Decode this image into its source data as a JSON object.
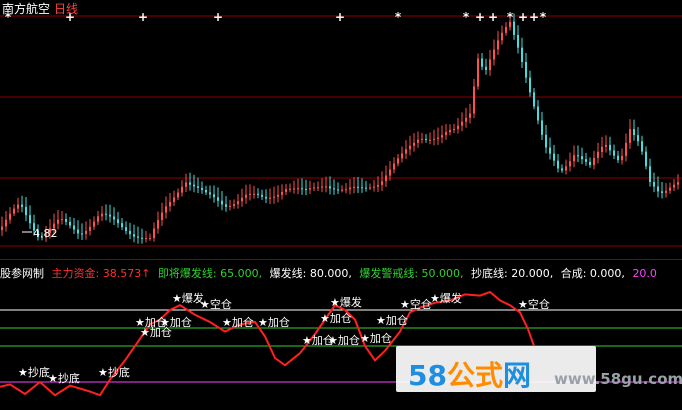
{
  "header": {
    "stock_name": "南方航空",
    "period": "日线"
  },
  "price_panel": {
    "low_marker": "4.82"
  },
  "indicator_bar": [
    {
      "text": "股参网制",
      "color": "#ffffff"
    },
    {
      "text": "主力资金: 38.573↑",
      "color": "#ff3030"
    },
    {
      "text": "即将爆发线: 65.000,",
      "color": "#30d030"
    },
    {
      "text": "爆发线: 80.000,",
      "color": "#ffffff"
    },
    {
      "text": "爆发警戒线: 50.000,",
      "color": "#30d030"
    },
    {
      "text": "抄底线: 20.000,",
      "color": "#ffffff"
    },
    {
      "text": "合成: 0.000,",
      "color": "#ffffff"
    },
    {
      "text": "20.0",
      "color": "#ff40ff"
    }
  ],
  "signals": [
    {
      "text": "★抄底",
      "label": "buy-bottom"
    },
    {
      "text": "★抄底",
      "label": "buy-bottom"
    },
    {
      "text": "★抄底",
      "label": "buy-bottom"
    },
    {
      "text": "★加仓",
      "label": "add-position"
    },
    {
      "text": "★加仓",
      "label": "add-position"
    },
    {
      "text": "★加仓",
      "label": "add-position"
    },
    {
      "text": "★加仓",
      "label": "add-position"
    },
    {
      "text": "★加仓",
      "label": "add-position"
    },
    {
      "text": "★加仓",
      "label": "add-position"
    },
    {
      "text": "★加仓",
      "label": "add-position"
    },
    {
      "text": "★加仓",
      "label": "add-position"
    },
    {
      "text": "★加仓",
      "label": "add-position"
    },
    {
      "text": "★加仓",
      "label": "add-position"
    },
    {
      "text": "★爆发",
      "label": "burst"
    },
    {
      "text": "★爆发",
      "label": "burst"
    },
    {
      "text": "★爆发",
      "label": "burst"
    },
    {
      "text": "★空仓",
      "label": "empty-position"
    },
    {
      "text": "★空仓",
      "label": "empty-position"
    },
    {
      "text": "★空仓",
      "label": "empty-position"
    }
  ],
  "watermark": {
    "number": "58",
    "name": "公式",
    "suffix": "网",
    "url": "www.58gu.com"
  },
  "colors": {
    "up": "#ff5050",
    "down": "#40e0e0",
    "line": "#ff2020",
    "grid": "#8b0000"
  }
}
